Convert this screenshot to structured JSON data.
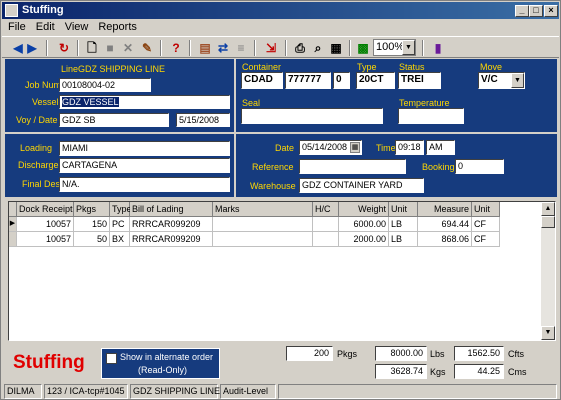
{
  "window": {
    "title": "Stuffing",
    "min": "_",
    "max": "□",
    "close": "×"
  },
  "menu": {
    "file": "File",
    "edit": "Edit",
    "view": "View",
    "reports": "Reports"
  },
  "toolbar": {
    "zoom": "100%"
  },
  "header": {
    "line_label": "Line",
    "line_value": "GDZ SHIPPING LINE",
    "job_label": "Job Num",
    "job_value": "00108004-02",
    "vessel_label": "Vessel",
    "vessel_value": "GDZ VESSEL",
    "voy_label": "Voy / Date",
    "voy_value": "GDZ SB",
    "voy_date": "5/15/2008",
    "container_label": "Container",
    "container_prefix": "CDAD",
    "container_number": "777777",
    "container_check": "0",
    "type_label": "Type",
    "type_value": "20CT",
    "status_label": "Status",
    "status_value": "TREI",
    "move_label": "Move",
    "move_value": "V/C",
    "seal_label": "Seal",
    "seal_value": "",
    "temp_label": "Temperature",
    "temp_value": "",
    "loading_label": "Loading",
    "loading_value": "MIAMI",
    "discharge_label": "Discharge",
    "discharge_value": "CARTAGENA",
    "final_label": "Final Dest",
    "final_value": "N/A.",
    "date_label": "Date",
    "date_value": "05/14/2008",
    "time_label": "Time",
    "time_value": "09:18",
    "ampm_value": "AM",
    "reference_label": "Reference",
    "reference_value": "",
    "booking_label": "Booking",
    "booking_value": "0",
    "warehouse_label": "Warehouse",
    "warehouse_value": "GDZ CONTAINER YARD"
  },
  "grid": {
    "columns": [
      "Dock Receipt",
      "Pkgs",
      "Type",
      "Bill of Lading",
      "Marks",
      "H/C",
      "Weight",
      "Unit",
      "Measure",
      "Unit"
    ],
    "rows": [
      [
        "10057",
        "150",
        "PC",
        "RRRCAR099209",
        "",
        "",
        "6000.00",
        "LB",
        "694.44",
        "CF"
      ],
      [
        "10057",
        "50",
        "BX",
        "RRRCAR099209",
        "",
        "",
        "2000.00",
        "LB",
        "868.06",
        "CF"
      ]
    ]
  },
  "footer": {
    "title": "Stuffing",
    "alt_order_line1": "Show in alternate order",
    "alt_order_line2": "(Read-Only)",
    "pkgs_value": "200",
    "pkgs_label": "Pkgs",
    "lbs_value": "8000.00",
    "lbs_label": "Lbs",
    "cfts_value": "1562.50",
    "cfts_label": "Cfts",
    "kgs_value": "3628.74",
    "kgs_label": "Kgs",
    "cms_value": "44.25",
    "cms_label": "Cms"
  },
  "status": {
    "user": "DILMA",
    "session": "123 / ICA-tcp#1045",
    "line": "GDZ SHIPPING LINE",
    "level": "Audit-Level"
  }
}
